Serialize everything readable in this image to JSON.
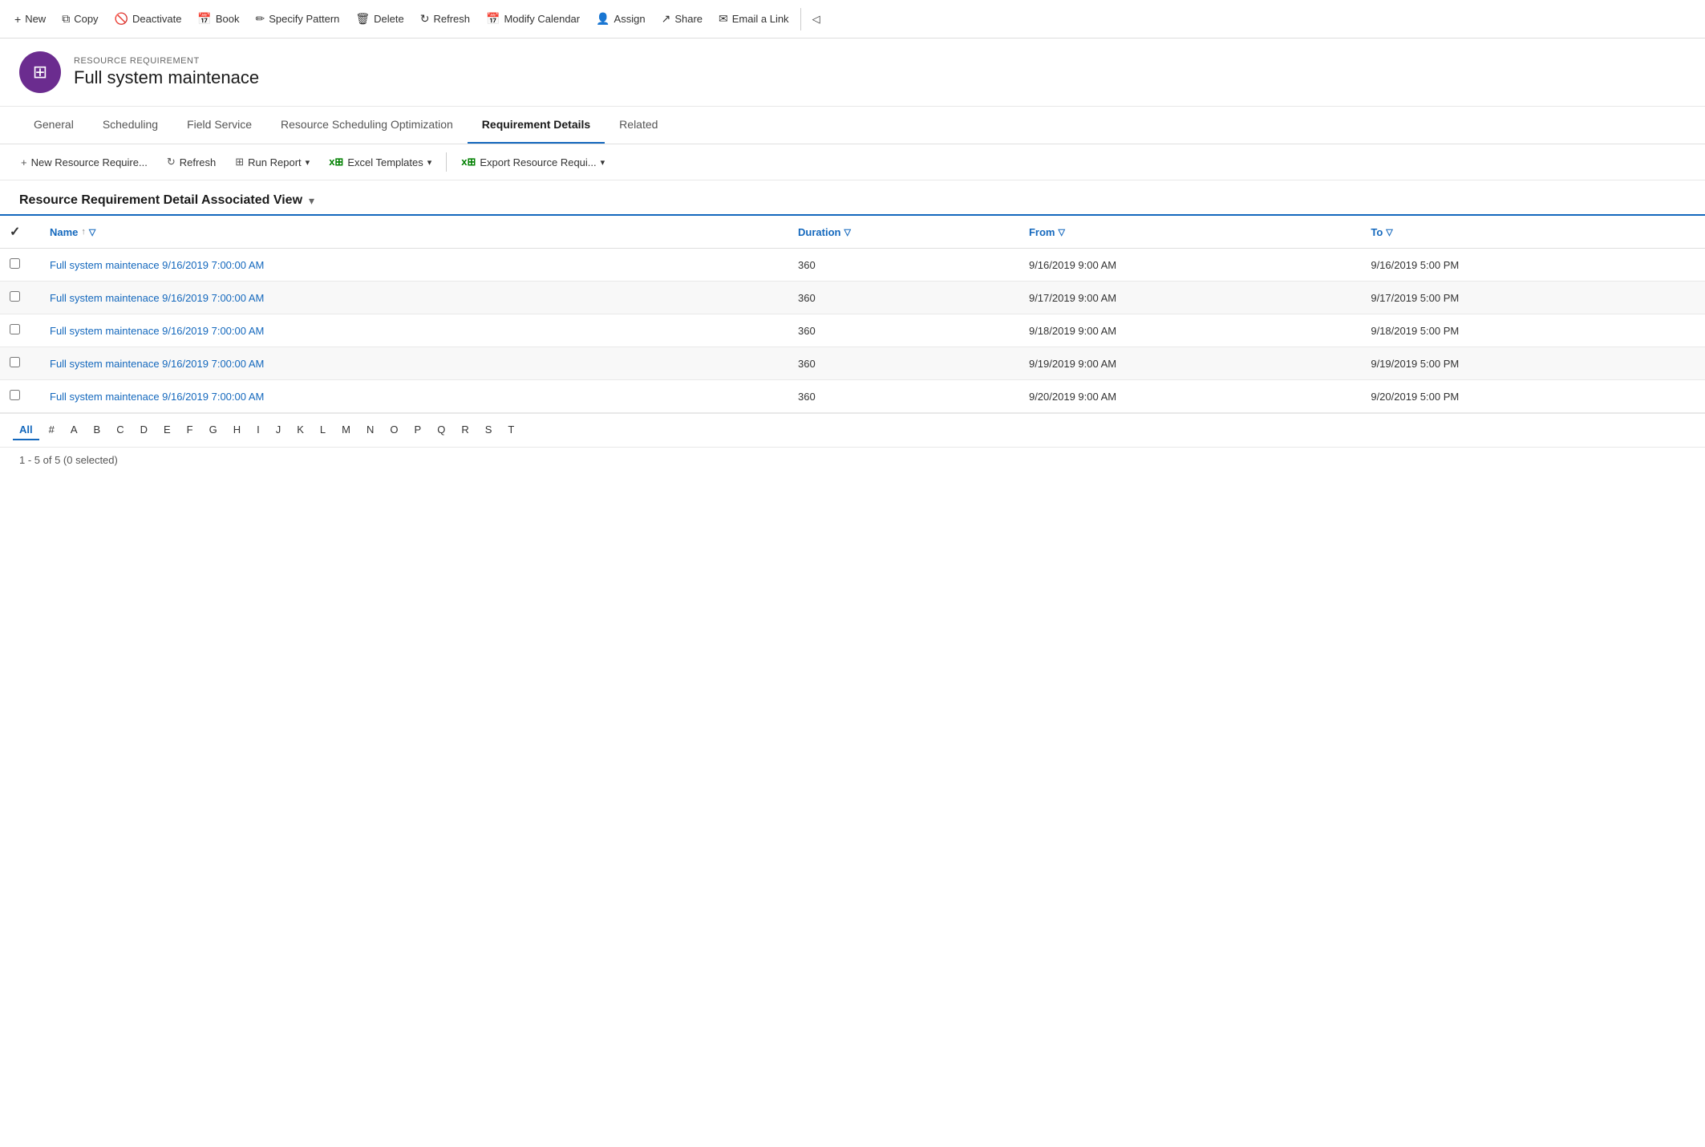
{
  "toolbar": {
    "buttons": [
      {
        "id": "new",
        "label": "New",
        "icon": "+"
      },
      {
        "id": "copy",
        "label": "Copy",
        "icon": "⧉"
      },
      {
        "id": "deactivate",
        "label": "Deactivate",
        "icon": "🚫"
      },
      {
        "id": "book",
        "label": "Book",
        "icon": "📅"
      },
      {
        "id": "specify-pattern",
        "label": "Specify Pattern",
        "icon": "✏"
      },
      {
        "id": "delete",
        "label": "Delete",
        "icon": "🗑"
      },
      {
        "id": "refresh",
        "label": "Refresh",
        "icon": "↻"
      },
      {
        "id": "modify-calendar",
        "label": "Modify Calendar",
        "icon": "📅"
      },
      {
        "id": "assign",
        "label": "Assign",
        "icon": "👤"
      },
      {
        "id": "share",
        "label": "Share",
        "icon": "↗"
      },
      {
        "id": "email-link",
        "label": "Email a Link",
        "icon": "✉"
      }
    ]
  },
  "header": {
    "entity_type": "RESOURCE REQUIREMENT",
    "entity_name": "Full system maintenace",
    "icon_symbol": "⊞"
  },
  "nav": {
    "tabs": [
      {
        "id": "general",
        "label": "General",
        "active": false
      },
      {
        "id": "scheduling",
        "label": "Scheduling",
        "active": false
      },
      {
        "id": "field-service",
        "label": "Field Service",
        "active": false
      },
      {
        "id": "rso",
        "label": "Resource Scheduling Optimization",
        "active": false
      },
      {
        "id": "requirement-details",
        "label": "Requirement Details",
        "active": true
      },
      {
        "id": "related",
        "label": "Related",
        "active": false
      }
    ]
  },
  "sub_toolbar": {
    "buttons": [
      {
        "id": "new-resource-require",
        "label": "New Resource Require...",
        "icon": "+"
      },
      {
        "id": "refresh",
        "label": "Refresh",
        "icon": "↻"
      },
      {
        "id": "run-report",
        "label": "Run Report",
        "icon": "⊞",
        "dropdown": true
      },
      {
        "id": "excel-templates",
        "label": "Excel Templates",
        "icon": "x⊞",
        "dropdown": true
      },
      {
        "id": "export-resource",
        "label": "Export Resource Requi...",
        "icon": "x⊞",
        "dropdown": true
      }
    ]
  },
  "view": {
    "title": "Resource Requirement Detail Associated View",
    "has_dropdown": true
  },
  "table": {
    "columns": [
      {
        "id": "name",
        "label": "Name",
        "sortable": true,
        "filterable": true
      },
      {
        "id": "duration",
        "label": "Duration",
        "sortable": false,
        "filterable": true
      },
      {
        "id": "from",
        "label": "From",
        "sortable": false,
        "filterable": true
      },
      {
        "id": "to",
        "label": "To",
        "sortable": false,
        "filterable": true
      }
    ],
    "rows": [
      {
        "id": "row1",
        "name": "Full system maintenace 9/16/2019 7:00:00 AM",
        "duration": "360",
        "from": "9/16/2019 9:00 AM",
        "to": "9/16/2019 5:00 PM"
      },
      {
        "id": "row2",
        "name": "Full system maintenace 9/16/2019 7:00:00 AM",
        "duration": "360",
        "from": "9/17/2019 9:00 AM",
        "to": "9/17/2019 5:00 PM"
      },
      {
        "id": "row3",
        "name": "Full system maintenace 9/16/2019 7:00:00 AM",
        "duration": "360",
        "from": "9/18/2019 9:00 AM",
        "to": "9/18/2019 5:00 PM"
      },
      {
        "id": "row4",
        "name": "Full system maintenace 9/16/2019 7:00:00 AM",
        "duration": "360",
        "from": "9/19/2019 9:00 AM",
        "to": "9/19/2019 5:00 PM"
      },
      {
        "id": "row5",
        "name": "Full system maintenace 9/16/2019 7:00:00 AM",
        "duration": "360",
        "from": "9/20/2019 9:00 AM",
        "to": "9/20/2019 5:00 PM"
      }
    ]
  },
  "pagination": {
    "letters": [
      "All",
      "#",
      "A",
      "B",
      "C",
      "D",
      "E",
      "F",
      "G",
      "H",
      "I",
      "J",
      "K",
      "L",
      "M",
      "N",
      "O",
      "P",
      "Q",
      "R",
      "S",
      "T"
    ],
    "active": "All"
  },
  "record_count": "1 - 5 of 5 (0 selected)"
}
